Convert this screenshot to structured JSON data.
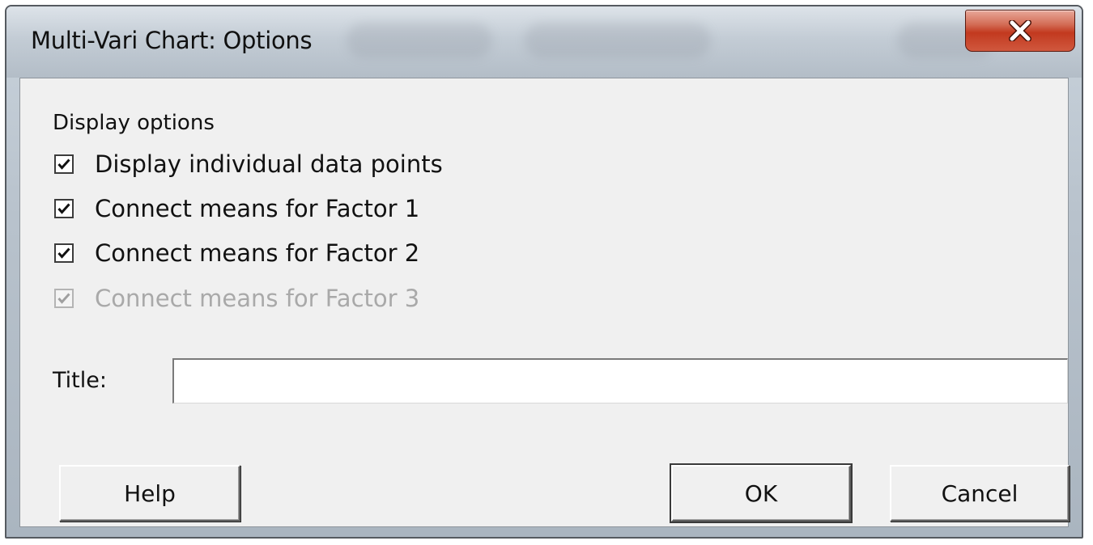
{
  "window": {
    "title": "Multi-Vari Chart: Options"
  },
  "display_options": {
    "group_label": "Display options",
    "checkboxes": [
      {
        "label": "Display individual data points",
        "checked": true,
        "enabled": true
      },
      {
        "label": "Connect means for Factor 1",
        "checked": true,
        "enabled": true
      },
      {
        "label": "Connect means for Factor 2",
        "checked": true,
        "enabled": true
      },
      {
        "label": "Connect means for Factor 3",
        "checked": true,
        "enabled": false
      }
    ]
  },
  "title_field": {
    "label": "Title:",
    "value": ""
  },
  "buttons": {
    "help": "Help",
    "ok": "OK",
    "cancel": "Cancel"
  },
  "colors": {
    "close_button": "#c2391f",
    "dialog_background": "#f0f0f0",
    "disabled_text": "#a9a9a9"
  },
  "icons": {
    "close": "close-icon",
    "check": "check-icon"
  }
}
